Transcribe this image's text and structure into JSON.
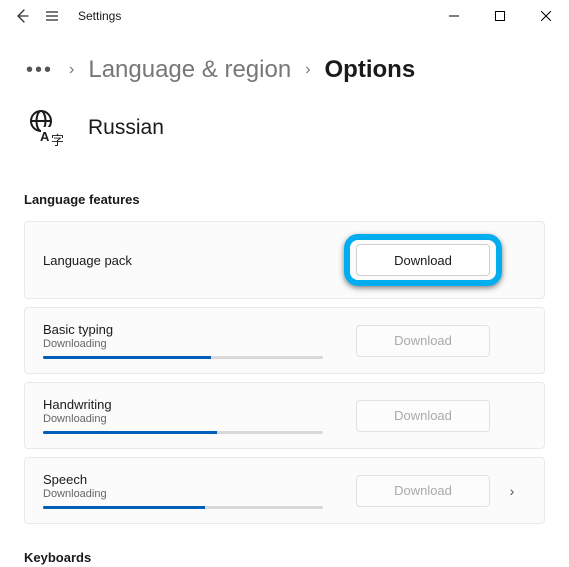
{
  "titlebar": {
    "app_name": "Settings"
  },
  "breadcrumb": {
    "ellipsis": "•••",
    "parent": "Language & region",
    "current": "Options"
  },
  "language": {
    "name": "Russian"
  },
  "sections": {
    "features_title": "Language features",
    "keyboards_title": "Keyboards"
  },
  "features": [
    {
      "title": "Language pack",
      "status": "",
      "progress": null,
      "button": "Download",
      "enabled": true,
      "has_chevron": false
    },
    {
      "title": "Basic typing",
      "status": "Downloading",
      "progress": 60,
      "button": "Download",
      "enabled": false,
      "has_chevron": false
    },
    {
      "title": "Handwriting",
      "status": "Downloading",
      "progress": 62,
      "button": "Download",
      "enabled": false,
      "has_chevron": false
    },
    {
      "title": "Speech",
      "status": "Downloading",
      "progress": 58,
      "button": "Download",
      "enabled": false,
      "has_chevron": true
    }
  ]
}
